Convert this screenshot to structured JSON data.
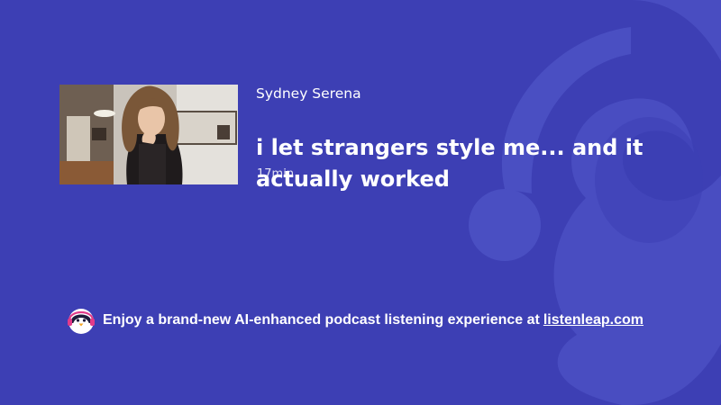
{
  "episode": {
    "author": "Sydney Serena",
    "title": "i let strangers style me... and it actually worked",
    "duration": "17min"
  },
  "promo": {
    "text": "Enjoy a brand-new AI-enhanced podcast listening experience at",
    "link_text": "listenleap.com"
  },
  "icons": {
    "brand_logo": "penguin-headphones-icon",
    "background_watermark": "headphones-watermark-icon"
  },
  "colors": {
    "background": "#3d3fb4",
    "watermark": "#4d52c4",
    "text": "#ffffff"
  }
}
